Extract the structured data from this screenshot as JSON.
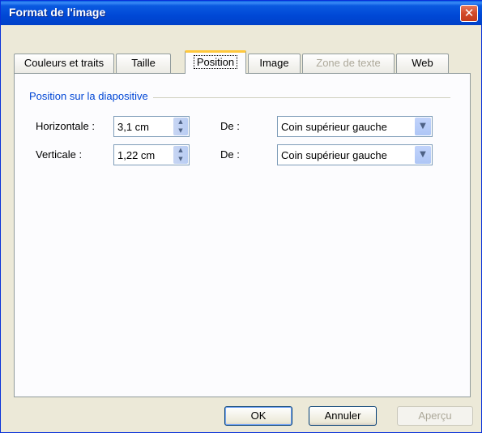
{
  "window": {
    "title": "Format de l'image",
    "close_glyph": "✕"
  },
  "tabs": [
    {
      "label": "Couleurs et traits",
      "state": "normal"
    },
    {
      "label": "Taille",
      "state": "normal"
    },
    {
      "label": "Position",
      "state": "active"
    },
    {
      "label": "Image",
      "state": "normal"
    },
    {
      "label": "Zone de texte",
      "state": "disabled"
    },
    {
      "label": "Web",
      "state": "normal"
    }
  ],
  "group": {
    "title": "Position sur la diapositive"
  },
  "horizontal": {
    "label": "Horizontale :",
    "value": "3,1 cm",
    "from_label": "De :",
    "from_value": "Coin supérieur gauche"
  },
  "vertical": {
    "label": "Verticale :",
    "value": "1,22 cm",
    "from_label": "De :",
    "from_value": "Coin supérieur gauche"
  },
  "buttons": {
    "ok": "OK",
    "cancel": "Annuler",
    "preview": "Aperçu"
  },
  "icons": {
    "close": "close-icon",
    "spin_up": "triangle-up-icon",
    "spin_down": "triangle-down-icon",
    "dropdown": "chevron-down-icon"
  },
  "colors": {
    "titlebar": "#0054e3",
    "group_title": "#0046d5",
    "active_tab_accent": "#ffc83c",
    "close_button": "#d24a2a"
  }
}
